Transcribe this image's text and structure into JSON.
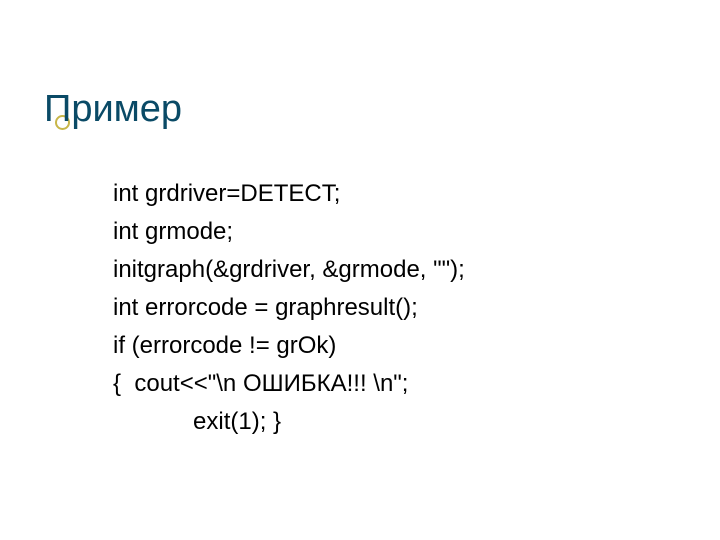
{
  "title": "Пример",
  "code": {
    "l1": "int grdriver=DETECT;",
    "l2": "int grmode;",
    "l3": "initgraph(&grdriver, &grmode, \"\");",
    "l4": "int errorcode = graphresult();",
    "l5": "if (errorcode != grOk)",
    "l6": "{  cout<<\"\\n ОШИБКА!!! \\n\";",
    "l7": "            exit(1); }"
  }
}
